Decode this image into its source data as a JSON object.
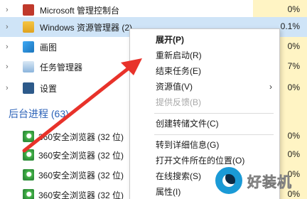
{
  "processes": [
    {
      "label": "Microsoft 管理控制台",
      "pct": "0%"
    },
    {
      "label": "Windows 资源管理器 (2)",
      "pct": "0.1%"
    },
    {
      "label": "画图",
      "pct": "0%"
    },
    {
      "label": "任务管理器",
      "pct": "7%"
    },
    {
      "label": "设置",
      "pct": "0%"
    }
  ],
  "section_title": "后台进程 (63)",
  "background": [
    {
      "label": "360安全浏览器 (32 位)",
      "pct": "0%"
    },
    {
      "label": "360安全浏览器 (32 位)",
      "pct": "0%"
    },
    {
      "label": "360安全浏览器 (32 位)",
      "pct": "0%"
    },
    {
      "label": "360安全浏览器 (32 位)",
      "pct": "0%"
    }
  ],
  "context_menu": {
    "items": [
      {
        "label": "展开(P)"
      },
      {
        "label": "重新启动(R)"
      },
      {
        "label": "结束任务(E)"
      },
      {
        "label": "资源值(V)",
        "submenu": "›"
      },
      {
        "label": "提供反馈(B)"
      },
      {
        "label": "创建转储文件(C)"
      },
      {
        "label": "转到详细信息(G)"
      },
      {
        "label": "打开文件所在的位置(O)"
      },
      {
        "label": "在线搜索(S)"
      },
      {
        "label": "属性(I)"
      }
    ]
  },
  "watermark": {
    "text": "好装机"
  },
  "colors": {
    "accent": "#2b62b8",
    "selected_row": "#cfe4f7",
    "cpu_column": "#fff4c4",
    "arrow": "#e8322a"
  }
}
